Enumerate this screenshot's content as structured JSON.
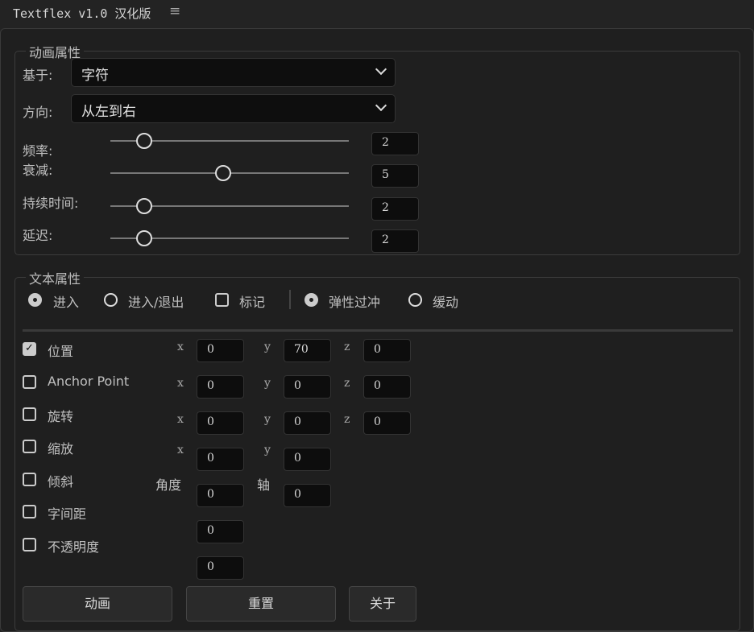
{
  "title": "Textflex v1.0 汉化版",
  "menu_icon": "hamburger-icon",
  "anim": {
    "legend": "动画属性",
    "based_label": "基于:",
    "based_value": "字符",
    "dir_label": "方向:",
    "dir_value": "从左到右",
    "sliders": [
      {
        "label": "频率:",
        "value": 2,
        "min": 1,
        "max": 10
      },
      {
        "label": "衰减:",
        "value": 5,
        "min": 1,
        "max": 10
      },
      {
        "label": "持续时间:",
        "value": 2,
        "min": 1,
        "max": 10
      },
      {
        "label": "延迟:",
        "value": 2,
        "min": 1,
        "max": 10
      }
    ]
  },
  "text": {
    "legend": "文本属性",
    "options": [
      {
        "label": "进入",
        "type": "radio",
        "checked": true
      },
      {
        "label": "进入/退出",
        "type": "radio",
        "checked": false
      },
      {
        "label": "标记",
        "type": "checkbox",
        "checked": false
      },
      {
        "label": "弹性过冲",
        "type": "radio",
        "checked": true
      },
      {
        "label": "缓动",
        "type": "radio",
        "checked": false
      }
    ],
    "props": [
      {
        "label": "位置",
        "checked": true
      },
      {
        "label": "Anchor Point",
        "checked": false
      },
      {
        "label": "旋转",
        "checked": false
      },
      {
        "label": "缩放",
        "checked": false
      },
      {
        "label": "倾斜",
        "checked": false
      },
      {
        "label": "字间距",
        "checked": false
      },
      {
        "label": "不透明度",
        "checked": false
      }
    ],
    "axes": {
      "x": "x",
      "y": "y",
      "z": "z",
      "angle": "角度",
      "axis": "轴"
    },
    "position": [
      "0",
      "70",
      "0"
    ],
    "anchor": [
      "0",
      "0",
      "0"
    ],
    "rotation": [
      "0",
      "0",
      "0"
    ],
    "scale": [
      "0",
      "0"
    ],
    "skew": [
      "0",
      "0"
    ],
    "tracking": "0",
    "opacity": "0"
  },
  "buttons": {
    "animate": "动画",
    "reset": "重置",
    "about": "关于"
  }
}
